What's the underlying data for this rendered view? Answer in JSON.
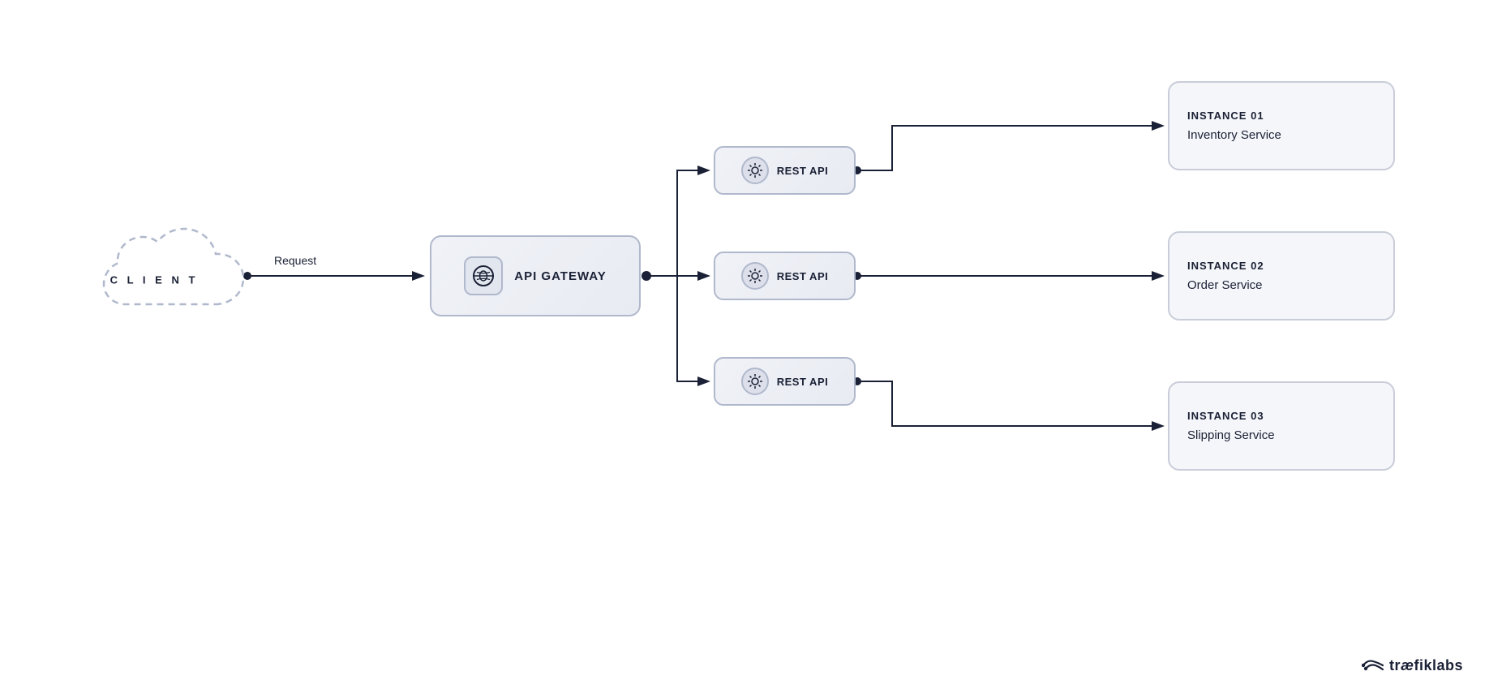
{
  "diagram": {
    "background": "#ffffff",
    "client": {
      "label": "C L I E N T"
    },
    "request_label": "Request",
    "gateway": {
      "label": "API GATEWAY",
      "icon": "⚙"
    },
    "rest_apis": [
      {
        "label": "REST API",
        "icon": "⚙"
      },
      {
        "label": "REST API",
        "icon": "⚙"
      },
      {
        "label": "REST API",
        "icon": "⚙"
      }
    ],
    "instances": [
      {
        "number": "INSTANCE 01",
        "name": "Inventory Service"
      },
      {
        "number": "INSTANCE 02",
        "name": "Order Service"
      },
      {
        "number": "INSTANCE 03",
        "name": "Slipping Service"
      }
    ],
    "logo": {
      "icon": "⇆",
      "text": "træfiklabs"
    }
  }
}
